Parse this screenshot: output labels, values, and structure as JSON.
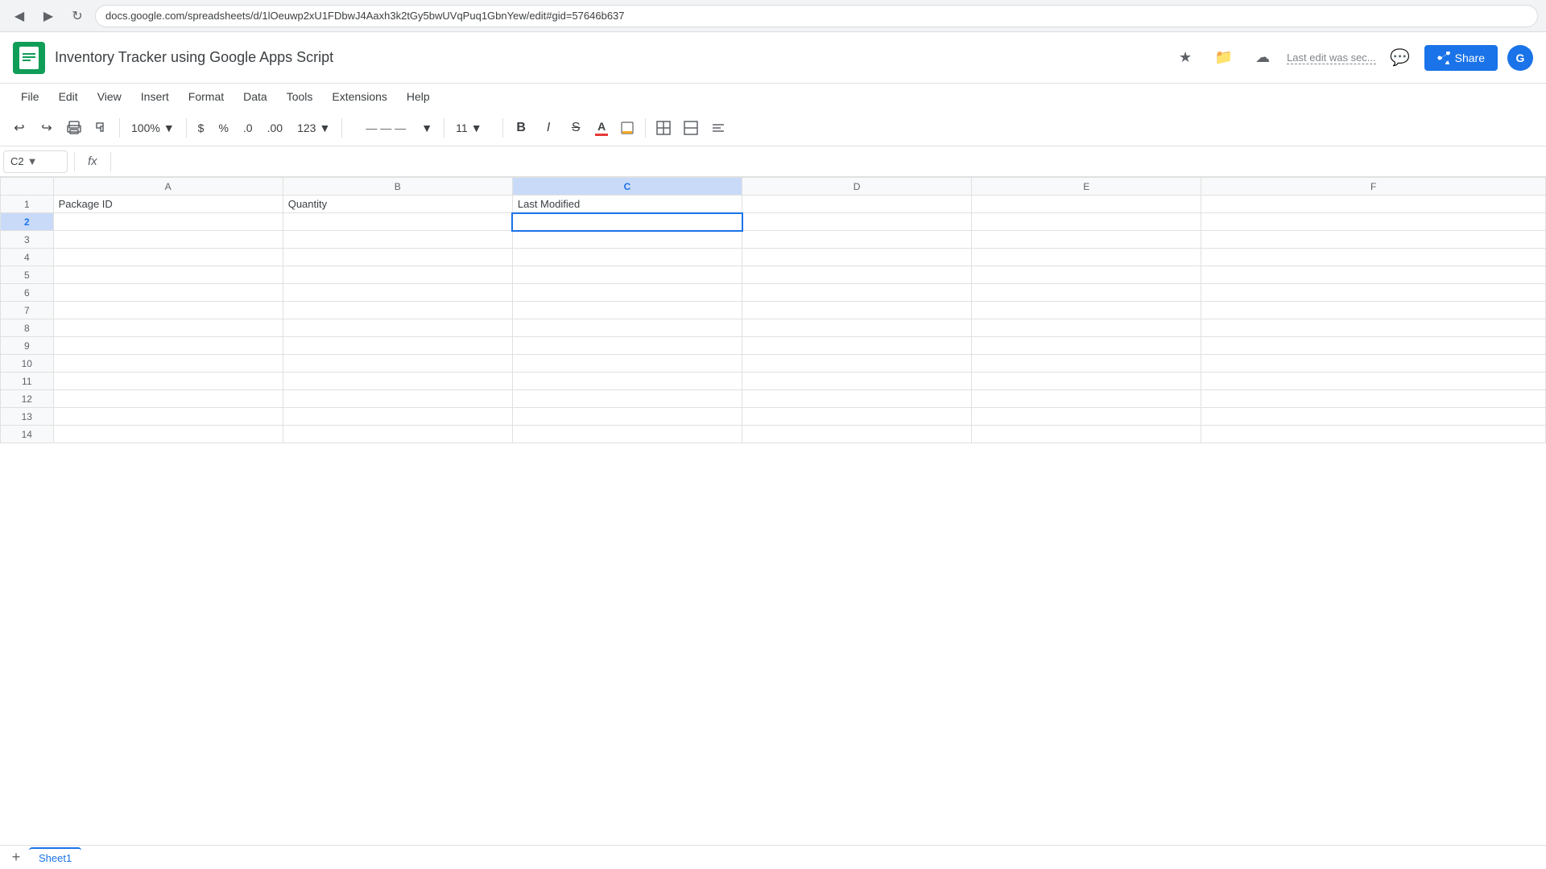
{
  "browser": {
    "url": "docs.google.com/spreadsheets/d/1lOeuwp2xU1FDbwJ4Aaxh3k2tGy5bwUVqPuq1GbnYew/edit#gid=57646b637",
    "back_btn": "◀",
    "forward_btn": "▶",
    "refresh_btn": "↻"
  },
  "app": {
    "title": "Inventory Tracker using Google Apps Script",
    "logo_letter": "S",
    "last_edit": "Last edit was sec...",
    "share_label": "Share"
  },
  "menu": {
    "items": [
      "File",
      "Edit",
      "View",
      "Insert",
      "Format",
      "Data",
      "Tools",
      "Extensions",
      "Help"
    ]
  },
  "toolbar": {
    "undo": "↩",
    "redo": "↪",
    "print": "🖨",
    "paint": "🖌",
    "zoom": "100%",
    "currency": "$",
    "percent": "%",
    "decimal_dec": ".0",
    "decimal_inc": ".00",
    "format_number": "123",
    "font_name": "",
    "font_size": "11",
    "bold": "B",
    "italic": "I",
    "strikethrough": "S",
    "underline": "A",
    "text_color": "A",
    "fill_color": "◆",
    "borders": "⊞",
    "merge": "⊟"
  },
  "formula_bar": {
    "cell_ref": "C2",
    "fx_label": "fx"
  },
  "grid": {
    "columns": [
      "A",
      "B",
      "C",
      "D",
      "E",
      "F"
    ],
    "rows": [
      1,
      2,
      3,
      4,
      5,
      6,
      7,
      8,
      9,
      10,
      11,
      12,
      13,
      14
    ],
    "selected_cell": "C2",
    "selected_row": 2,
    "selected_col": "C",
    "headers": {
      "A1": "Package ID",
      "B1": "Quantity",
      "C1": "Last Modified"
    }
  },
  "sheet_tabs": {
    "active_tab": "Sheet1",
    "tabs": [
      "Sheet1"
    ]
  },
  "colors": {
    "selected_border": "#1a73e8",
    "selected_bg": "#c9daf8",
    "header_bg": "#f8f9fa",
    "grid_line": "#e0e0e0"
  }
}
